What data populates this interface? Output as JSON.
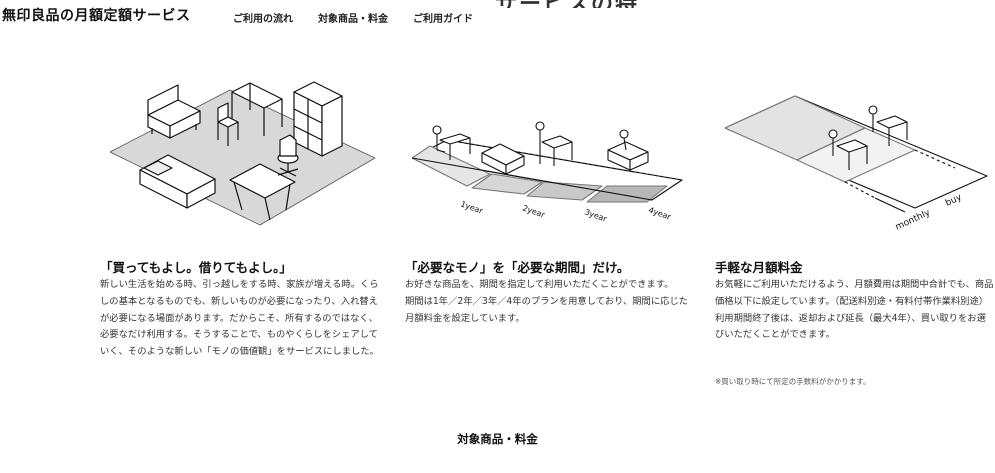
{
  "header": {
    "site_title": "無印良品の月額定額サービス",
    "nav": [
      "ご利用の流れ",
      "対象商品・料金",
      "ご利用ガイド"
    ]
  },
  "section_heading_partial": "サービスの特長",
  "illustrations": {
    "illus2_labels": [
      "1year",
      "2year",
      "3year",
      "4year"
    ],
    "illus3_labels": [
      "monthly",
      "buy"
    ]
  },
  "features": [
    {
      "title": "「買ってもよし。借りてもよし。」",
      "body": [
        "新しい生活を始める時、引っ越しをする時、家族が増える時。くらしの基本となるものでも、新しいものが必要になったり、入れ替えが必要になる場面があります。だからこそ、所有するのではなく、必要なだけ利用する。そうすることで、ものやくらしをシェアしていく、そのような新しい「モノの価値観」をサービスにしました。"
      ]
    },
    {
      "title": "「必要なモノ」を「必要な期間」だけ。",
      "body": [
        "お好きな商品を、期間を指定して利用いただくことができます。",
        "期間は1年／2年／3年／4年のプランを用意しており、期間に応じた月額料金を設定しています。"
      ]
    },
    {
      "title": "手軽な月額料金",
      "body": [
        "お気軽にご利用いただけるよう、月額費用は期間中合計でも、商品価格以下に設定しています。（配送料別途・有料付帯作業料別途）",
        "利用期間終了後は、返却および延長（最大4年）、買い取りをお選びいただくことができます。"
      ],
      "note": "※買い取り時にて所定の手数料がかかります。"
    }
  ],
  "bottom_heading": "対象商品・料金"
}
